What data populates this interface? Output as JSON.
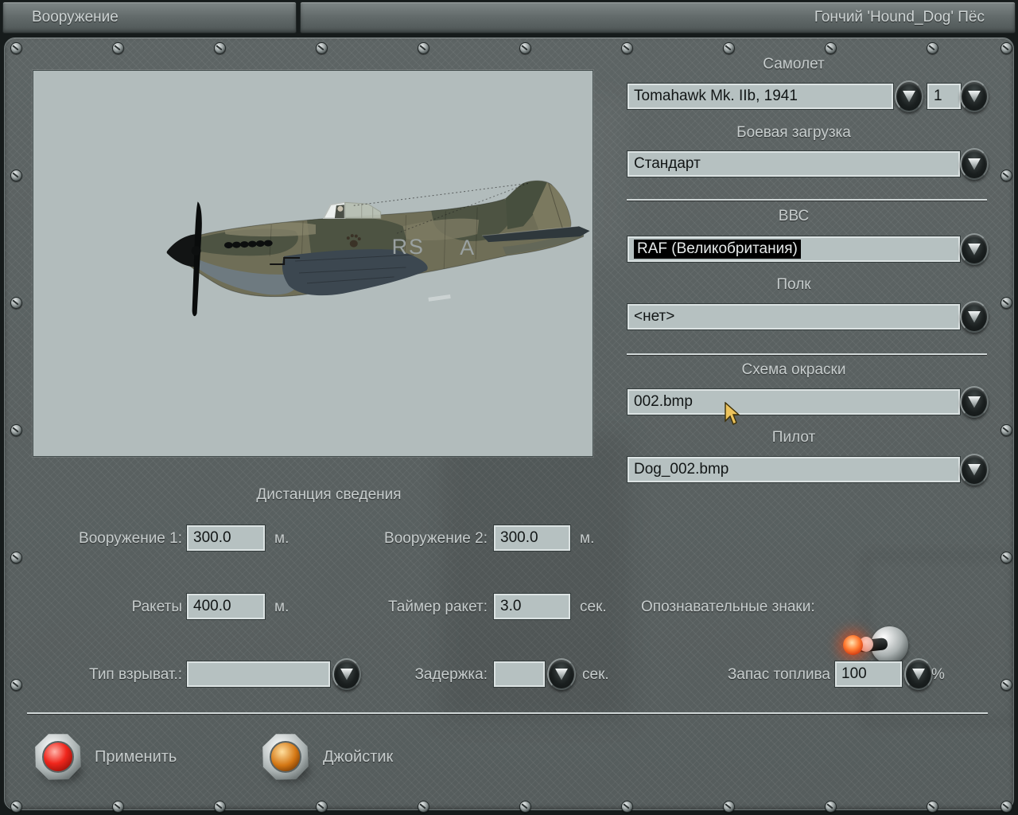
{
  "title_bar": {
    "left_tab": "Вооружение",
    "right_text": "Гончий 'Hound_Dog' Пёс"
  },
  "aircraft_panel": {
    "code_left": "RS",
    "code_right": "A"
  },
  "right_panel": {
    "aircraft": {
      "label": "Самолет",
      "value": "Tomahawk Mk. IIb, 1941",
      "count": "1"
    },
    "loadout": {
      "label": "Боевая загрузка",
      "value": "Стандарт"
    },
    "air_force": {
      "label": "ВВС",
      "value": "RAF (Великобритания)",
      "selected": true
    },
    "regiment": {
      "label": "Полк",
      "value": "<нет>"
    },
    "paint_scheme": {
      "label": "Схема окраски",
      "value": "002.bmp"
    },
    "pilot": {
      "label": "Пилот",
      "value": "Dog_002.bmp"
    }
  },
  "convergence": {
    "heading": "Дистанция сведения",
    "weapon1": {
      "label": "Вооружение 1:",
      "value": "300.0",
      "unit": "м."
    },
    "weapon2": {
      "label": "Вооружение 2:",
      "value": "300.0",
      "unit": "м."
    },
    "rockets": {
      "label": "Ракеты",
      "value": "400.0",
      "unit": "м."
    },
    "rocket_timer": {
      "label": "Таймер ракет:",
      "value": "3.0",
      "unit": "сек."
    },
    "markings": {
      "label": "Опознавательные знаки:",
      "state": "on"
    },
    "fuze_type": {
      "label": "Тип взрыват.:",
      "value": ""
    },
    "delay": {
      "label": "Задержка:",
      "value": "",
      "unit": "сек."
    },
    "fuel": {
      "label": "Запас топлива",
      "value": "100",
      "unit": "%"
    }
  },
  "footer": {
    "apply_label": "Применить",
    "joystick_label": "Джойстик"
  },
  "icons": {
    "dropdown": "dropdown-arrow-icon",
    "toggle": "toggle-switch-icon",
    "screw": "screw-icon"
  },
  "colors": {
    "field_bg": "#b6c1c1",
    "panel_bg": "#5b6262",
    "selection_bg": "#000000",
    "selection_text": "#e6eaea",
    "toggle_glow": "#ff4d1a",
    "apply_button": "#f0261c",
    "joystick_button": "#d47714",
    "viewport_bg": "#b2bcbc"
  }
}
